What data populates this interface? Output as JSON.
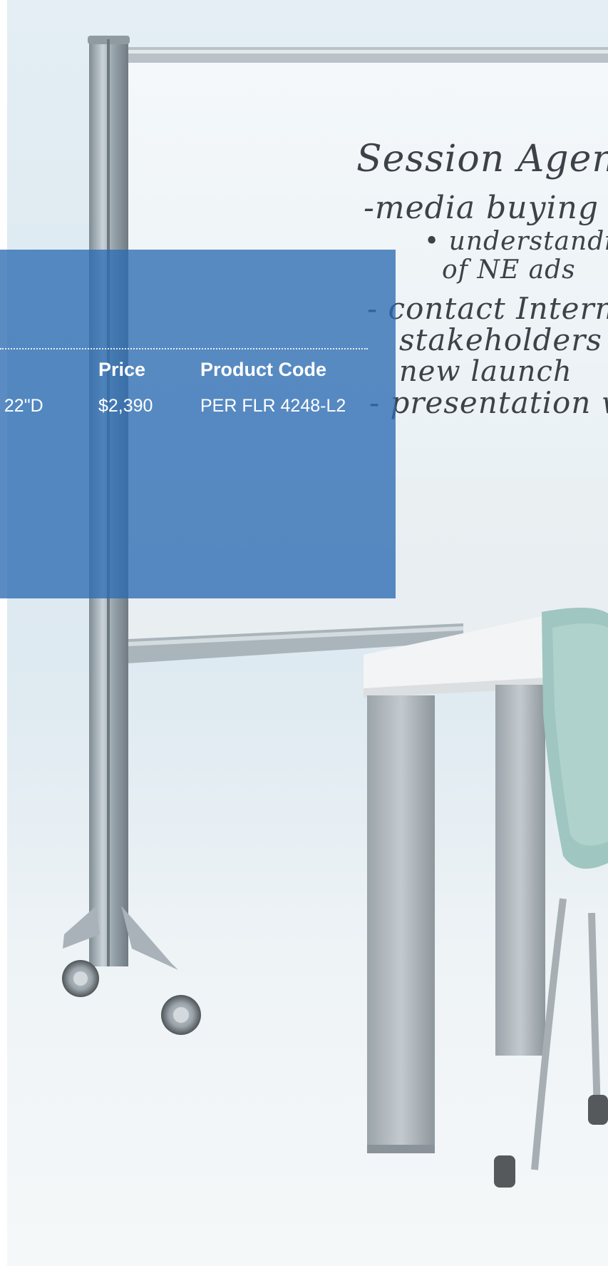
{
  "whiteboard": {
    "lines": [
      "Session Agenda",
      "-media buying pl",
      "• understandin",
      "of NE ads",
      "- contact Interna",
      "stakeholders re",
      "new launch",
      "- presentation w"
    ]
  },
  "spec_table": {
    "partial_dimension": ": 22\"D",
    "price_header": "Price",
    "product_code_header": "Product Code",
    "price_value": "$2,390",
    "product_code_value": "PER FLR 4248-L2"
  },
  "colors": {
    "panel_blue": "#2b6cb2",
    "frame_silver": "#a9b4bb",
    "chair_green": "#9fc6c0"
  }
}
